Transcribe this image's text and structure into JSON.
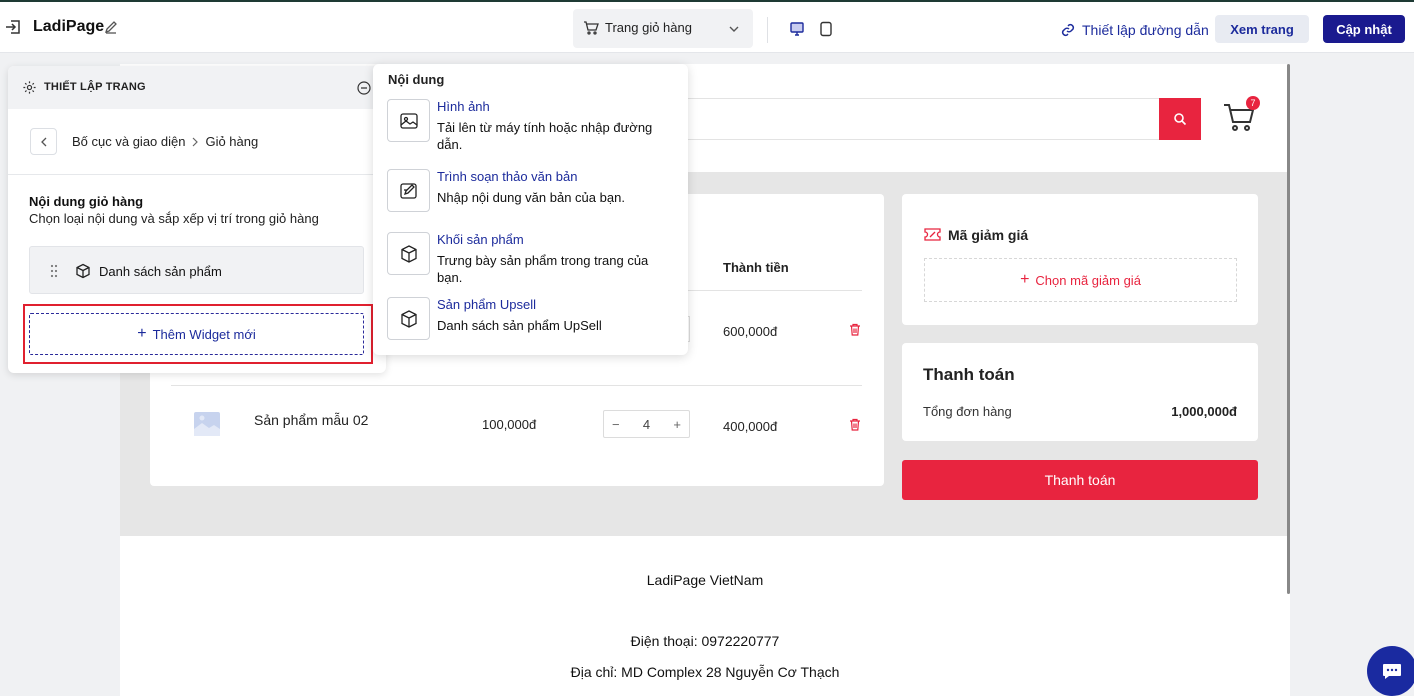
{
  "topbar": {
    "app_title": "LadiPage",
    "page_select": "Trang giỏ hàng",
    "link_label": "Thiết lập đường dẫn",
    "view_label": "Xem trang",
    "update_label": "Cập nhật"
  },
  "panel": {
    "title": "THIẾT LẬP TRANG",
    "breadcrumb_parent": "Bố cục và giao diện",
    "breadcrumb_current": "Giỏ hàng",
    "section_title": "Nội dung giỏ hàng",
    "section_desc": "Chọn loại nội dung và sắp xếp vị trí trong giỏ hàng",
    "widget_label": "Danh sách sản phẩm",
    "add_widget_label": "Thêm Widget mới"
  },
  "popup": {
    "title": "Nội dung",
    "options": [
      {
        "name": "Hình ảnh",
        "desc": "Tải lên từ máy tính hoặc nhập đường dẫn.",
        "icon": "image-icon"
      },
      {
        "name": "Trình soạn thảo văn bản",
        "desc": "Nhập nội dung văn bản của bạn.",
        "icon": "text-editor-icon"
      },
      {
        "name": "Khối sản phẩm",
        "desc": "Trưng bày sản phẩm trong trang của bạn.",
        "icon": "box-icon"
      },
      {
        "name": "Sản phẩm Upsell",
        "desc": "Danh sách sản phẩm UpSell",
        "icon": "box-icon"
      }
    ]
  },
  "cart": {
    "badge_count": "7",
    "col_total_header": "Thành tiền",
    "row1_total": "600,000đ",
    "row2": {
      "name": "Sản phẩm mẫu 02",
      "price": "100,000đ",
      "qty": "4",
      "total": "400,000đ"
    }
  },
  "coupon": {
    "title": "Mã giảm giá",
    "pick_label": "Chọn mã giảm giá"
  },
  "payment": {
    "title": "Thanh toán",
    "order_total_label": "Tổng đơn hàng",
    "order_total_value": "1,000,000đ",
    "button_label": "Thanh toán"
  },
  "footer": {
    "company": "LadiPage VietNam",
    "phone": "Điện thoại: 0972220777",
    "address": "Địa chỉ: MD Complex 28 Nguyễn Cơ Thạch"
  },
  "colors": {
    "brand": "#1a1a8f",
    "accent": "#e8243f",
    "highlight": "#e0202f"
  }
}
